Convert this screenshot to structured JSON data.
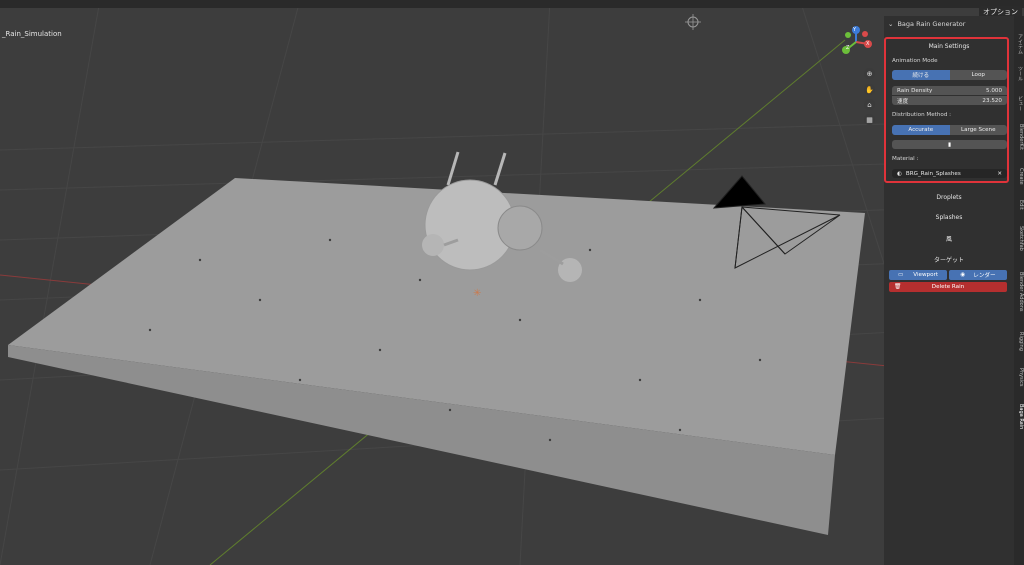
{
  "scene": {
    "name": "_Rain_Simulation"
  },
  "top": {
    "options_label": "オプション"
  },
  "gizmo": {
    "axes": [
      "Y",
      "X",
      "Z"
    ]
  },
  "panel": {
    "header": "Baga Rain Generator",
    "main_settings": "Main Settings",
    "animation_mode_label": "Animation Mode",
    "animation_mode_options": [
      "続ける",
      "Loop"
    ],
    "rain_density_label": "Rain Density",
    "rain_density_value": "5.000",
    "speed_label": "速度",
    "speed_value": "23.520",
    "distribution_label": "Distribution Method :",
    "distribution_options": [
      "Accurate",
      "Large Scene"
    ],
    "material_label": "Material :",
    "material_name": "BRG_Rain_Splashes",
    "droplets": "Droplets",
    "splashes": "Splashes",
    "wind": "風",
    "target": "ターゲット",
    "viewport_btn": "Viewport",
    "render_btn": "レンダー",
    "delete_btn": "Delete Rain"
  },
  "vtabs": [
    "アイテム",
    "ツール",
    "ビュー",
    "BlenderKit",
    "Create",
    "Edit",
    "Sketchfab",
    "Blender Addons",
    "Rigging",
    "Physics",
    "Baga Rain"
  ]
}
